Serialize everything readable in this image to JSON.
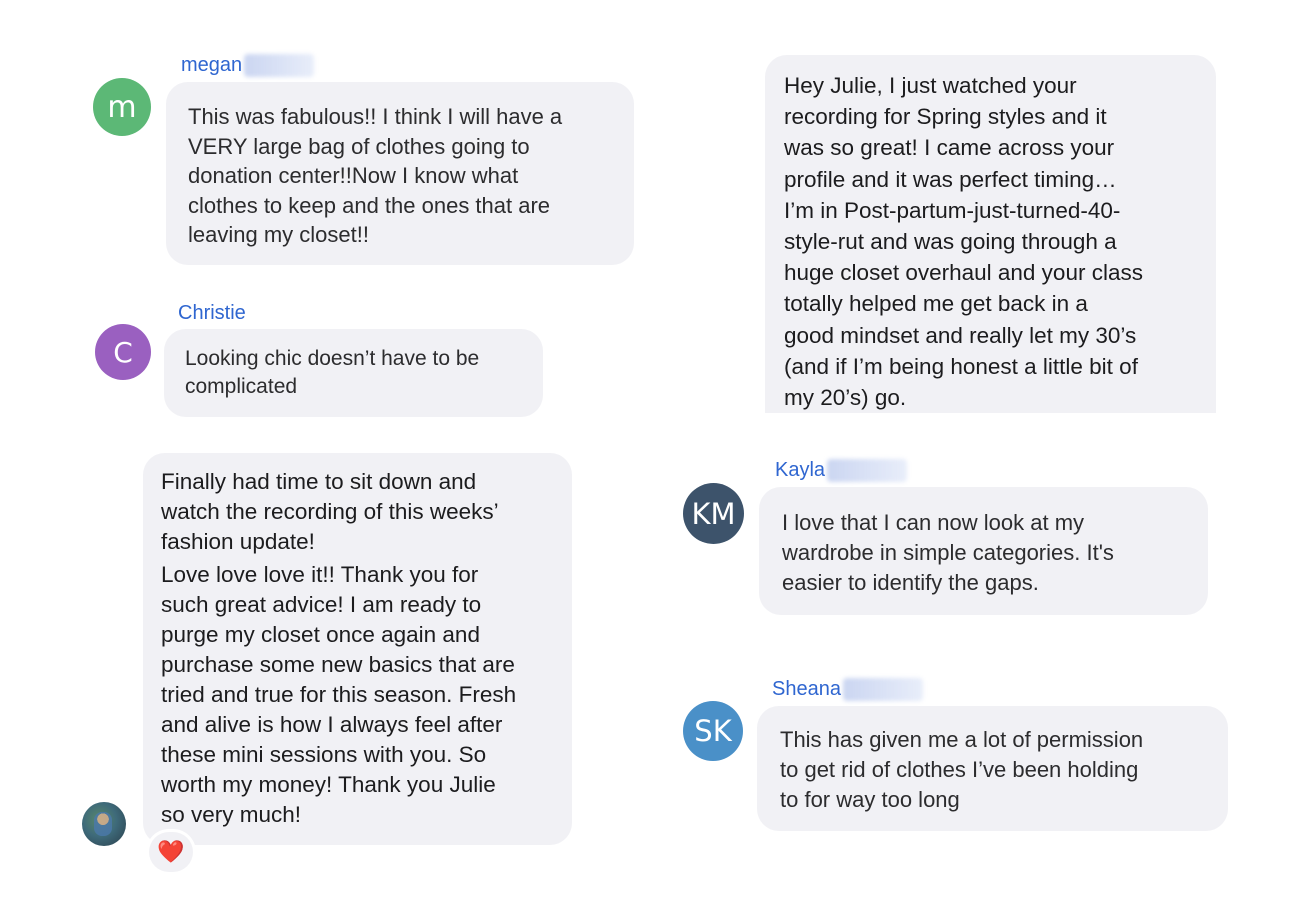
{
  "messages": [
    {
      "avatar_initials": "m",
      "avatar_color": "#5cb876",
      "sender_name": "megan",
      "text": "This was fabulous!! I think I will have a\nVERY large bag of clothes going to\ndonation center!!Now I know what\nclothes to keep and the ones that are\nleaving my closet!!"
    },
    {
      "avatar_initials": "C",
      "avatar_color": "#9a60c0",
      "sender_name": "Christie",
      "text": "Looking chic doesn’t have to be\ncomplicated"
    },
    {
      "avatar_type": "photo",
      "paragraphs": [
        "Finally had time to sit down and\nwatch the recording of this weeks’\nfashion update!",
        "Love love love it!! Thank you for\nsuch great advice! I am ready to\npurge my closet once again and\npurchase some new basics that are\ntried and true for this season. Fresh\nand alive is how I always feel after\nthese mini sessions with you. So\nworth my money! Thank you Julie\nso very much!"
      ],
      "reaction": "❤️"
    },
    {
      "text": "Hey Julie, I just watched your\nrecording for Spring styles and it\nwas so great! I came across your\nprofile and it was perfect timing…\nI’m in Post-partum-just-turned-40-\nstyle-rut and was going through a\nhuge closet overhaul and your class\ntotally helped me get back in a\ngood mindset and really let my 30’s\n(and if I’m being honest a little bit of\nmy 20’s) go."
    },
    {
      "avatar_initials": "KM",
      "avatar_color": "#3d536b",
      "sender_name": "Kayla",
      "text": "I love that I can now look at my\nwardrobe in simple categories. It's\neasier to identify the gaps."
    },
    {
      "avatar_initials": "SK",
      "avatar_color": "#4a90c8",
      "sender_name": "Sheana",
      "text": "This has given me a lot of permission\nto get rid of clothes I’ve been holding\nto for way too long"
    }
  ]
}
